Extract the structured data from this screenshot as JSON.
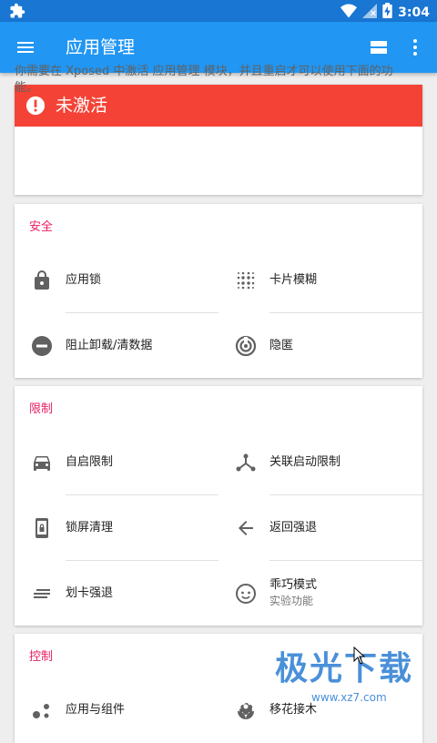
{
  "statusbar": {
    "time": "3:04"
  },
  "appbar": {
    "title": "应用管理"
  },
  "warning": {
    "title": "未激活",
    "message": "你需要在 Xposed 中激活 应用管理 模块，并且重启才可以使用下面的功能。"
  },
  "sections": [
    {
      "title": "安全",
      "items": [
        {
          "label": "应用锁",
          "icon": "lock-icon"
        },
        {
          "label": "卡片模糊",
          "icon": "blur-icon"
        },
        {
          "label": "阻止卸载/清数据",
          "icon": "block-icon"
        },
        {
          "label": "隐匿",
          "icon": "incognito-icon"
        }
      ]
    },
    {
      "title": "限制",
      "items": [
        {
          "label": "自启限制",
          "icon": "car-icon"
        },
        {
          "label": "关联启动限制",
          "icon": "network-icon"
        },
        {
          "label": "锁屏清理",
          "icon": "phone-lock-icon"
        },
        {
          "label": "返回强退",
          "icon": "back-arrow-icon"
        },
        {
          "label": "划卡强退",
          "icon": "swipe-icon"
        },
        {
          "label": "乖巧模式",
          "sub": "实验功能",
          "icon": "face-icon"
        }
      ]
    },
    {
      "title": "控制",
      "items": [
        {
          "label": "应用与组件",
          "icon": "components-icon"
        },
        {
          "label": "移花接木",
          "icon": "flower-icon"
        }
      ]
    }
  ],
  "watermark": {
    "big": "极光下载",
    "small": "www.xz7.com"
  },
  "colors": {
    "primary": "#2196f3",
    "primary_dark": "#1976d2",
    "warning": "#f44336",
    "section_title": "#e91e63"
  }
}
